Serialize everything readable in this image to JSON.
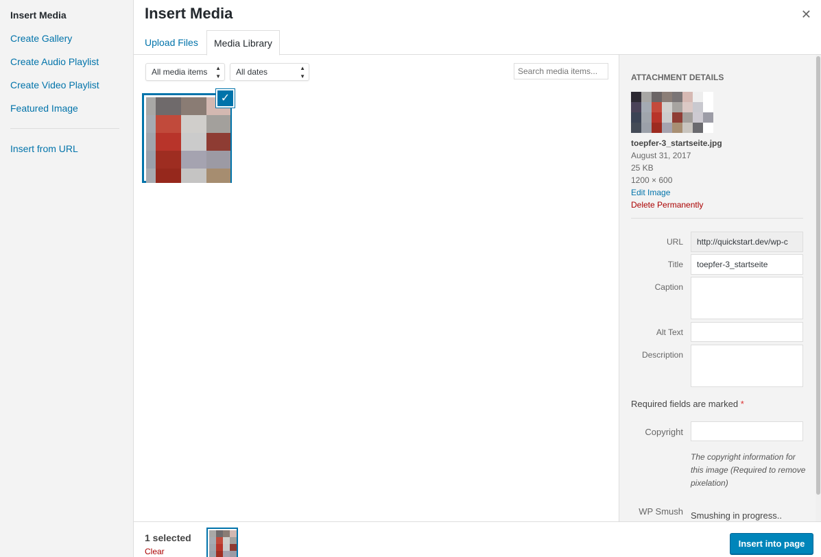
{
  "menu": {
    "items": [
      {
        "label": "Insert Media"
      },
      {
        "label": "Create Gallery"
      },
      {
        "label": "Create Audio Playlist"
      },
      {
        "label": "Create Video Playlist"
      },
      {
        "label": "Featured Image"
      },
      {
        "label": "Insert from URL"
      }
    ]
  },
  "frame": {
    "title": "Insert Media",
    "close_icon": "close-icon",
    "tabs": [
      {
        "label": "Upload Files"
      },
      {
        "label": "Media Library"
      }
    ]
  },
  "toolbar": {
    "type_filter": "All media items",
    "date_filter": "All dates",
    "search_placeholder": "Search media items..."
  },
  "attachment": {
    "selected": true,
    "check_icon": "checkmark-icon",
    "thumb_colors": [
      [
        "#a9a8a6",
        "#6f6a6b",
        "#8a7c74",
        "#d3b8b1"
      ],
      [
        "#a6abb2",
        "#c14a3b",
        "#d0cecb",
        "#a3a09c"
      ],
      [
        "#a1a5ac",
        "#b8342a",
        "#cbcbcb",
        "#8e3c33"
      ],
      [
        "#9aa0aa",
        "#9e2d21",
        "#a5a3b0",
        "#9c9aa4"
      ],
      [
        "#a7aab0",
        "#96281c",
        "#c5c4c3",
        "#a68d70"
      ]
    ]
  },
  "details": {
    "heading": "ATTACHMENT DETAILS",
    "thumb_colors": [
      [
        "#2d2a33",
        "#a7a6a4",
        "#6b6566",
        "#8b7e77",
        "#7a7576",
        "#d6b9b3",
        "#eeeeee",
        "#ffffff"
      ],
      [
        "#4a4258",
        "#a4aab3",
        "#c44a3c",
        "#d2d1ce",
        "#a7a4a0",
        "#dcc9c5",
        "#c9c9cf",
        "#ffffff"
      ],
      [
        "#3b4355",
        "#a0a5ac",
        "#b8342a",
        "#cccccc",
        "#8f3d34",
        "#a39f9b",
        "#cdcad1",
        "#9c9ca6"
      ],
      [
        "#444b57",
        "#9ba0a9",
        "#9d2b20",
        "#a5a3af",
        "#a88f73",
        "#c9c5bf",
        "#6a6a6e",
        "#ffffff"
      ]
    ],
    "filename": "toepfer-3_startseite.jpg",
    "date": "August 31, 2017",
    "size": "25 KB",
    "dimensions": "1200 × 600",
    "edit_link": "Edit Image",
    "delete_link": "Delete Permanently",
    "fields": {
      "url_label": "URL",
      "url_value": "http://quickstart.dev/wp-c",
      "title_label": "Title",
      "title_value": "toepfer-3_startseite",
      "caption_label": "Caption",
      "caption_value": "",
      "alt_label": "Alt Text",
      "alt_value": "",
      "description_label": "Description",
      "description_value": ""
    },
    "required_note": "Required fields are marked",
    "required_star": "*",
    "copyright_label": "Copyright",
    "copyright_value": "",
    "copyright_note": "The copyright information for this image (Required to remove pixelation)",
    "smush_label": "WP Smush",
    "smush_value": "Smushing in progress.."
  },
  "bottom": {
    "count": "1 selected",
    "clear": "Clear",
    "insert_button": "Insert into page"
  }
}
